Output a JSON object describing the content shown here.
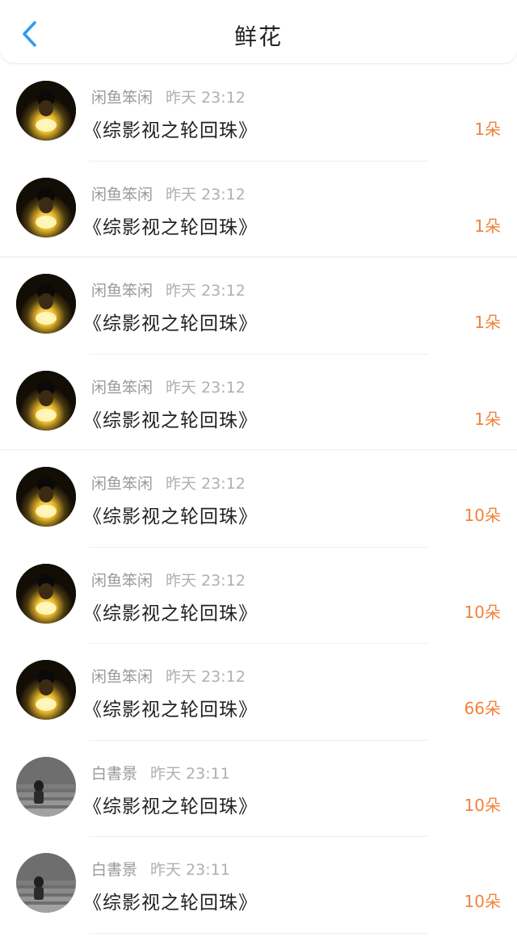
{
  "header": {
    "title": "鲜花",
    "back_icon": "chevron-left-icon",
    "accent": "#2f9cf2"
  },
  "colors": {
    "count": "#f0823a"
  },
  "items": [
    {
      "user": "闲鱼笨闲",
      "time": "昨天 23:12",
      "book": "《综影视之轮回珠》",
      "count": "1朵",
      "avatar": "dark-glow"
    },
    {
      "user": "闲鱼笨闲",
      "time": "昨天 23:12",
      "book": "《综影视之轮回珠》",
      "count": "1朵",
      "avatar": "dark-glow"
    },
    {
      "user": "闲鱼笨闲",
      "time": "昨天 23:12",
      "book": "《综影视之轮回珠》",
      "count": "1朵",
      "avatar": "dark-glow"
    },
    {
      "user": "闲鱼笨闲",
      "time": "昨天 23:12",
      "book": "《综影视之轮回珠》",
      "count": "1朵",
      "avatar": "dark-glow"
    },
    {
      "user": "闲鱼笨闲",
      "time": "昨天 23:12",
      "book": "《综影视之轮回珠》",
      "count": "10朵",
      "avatar": "dark-glow"
    },
    {
      "user": "闲鱼笨闲",
      "time": "昨天 23:12",
      "book": "《综影视之轮回珠》",
      "count": "10朵",
      "avatar": "dark-glow"
    },
    {
      "user": "闲鱼笨闲",
      "time": "昨天 23:12",
      "book": "《综影视之轮回珠》",
      "count": "66朵",
      "avatar": "dark-glow"
    },
    {
      "user": "白書景",
      "time": "昨天 23:11",
      "book": "《综影视之轮回珠》",
      "count": "10朵",
      "avatar": "gray-stairs"
    },
    {
      "user": "白書景",
      "time": "昨天 23:11",
      "book": "《综影视之轮回珠》",
      "count": "10朵",
      "avatar": "gray-stairs"
    }
  ]
}
